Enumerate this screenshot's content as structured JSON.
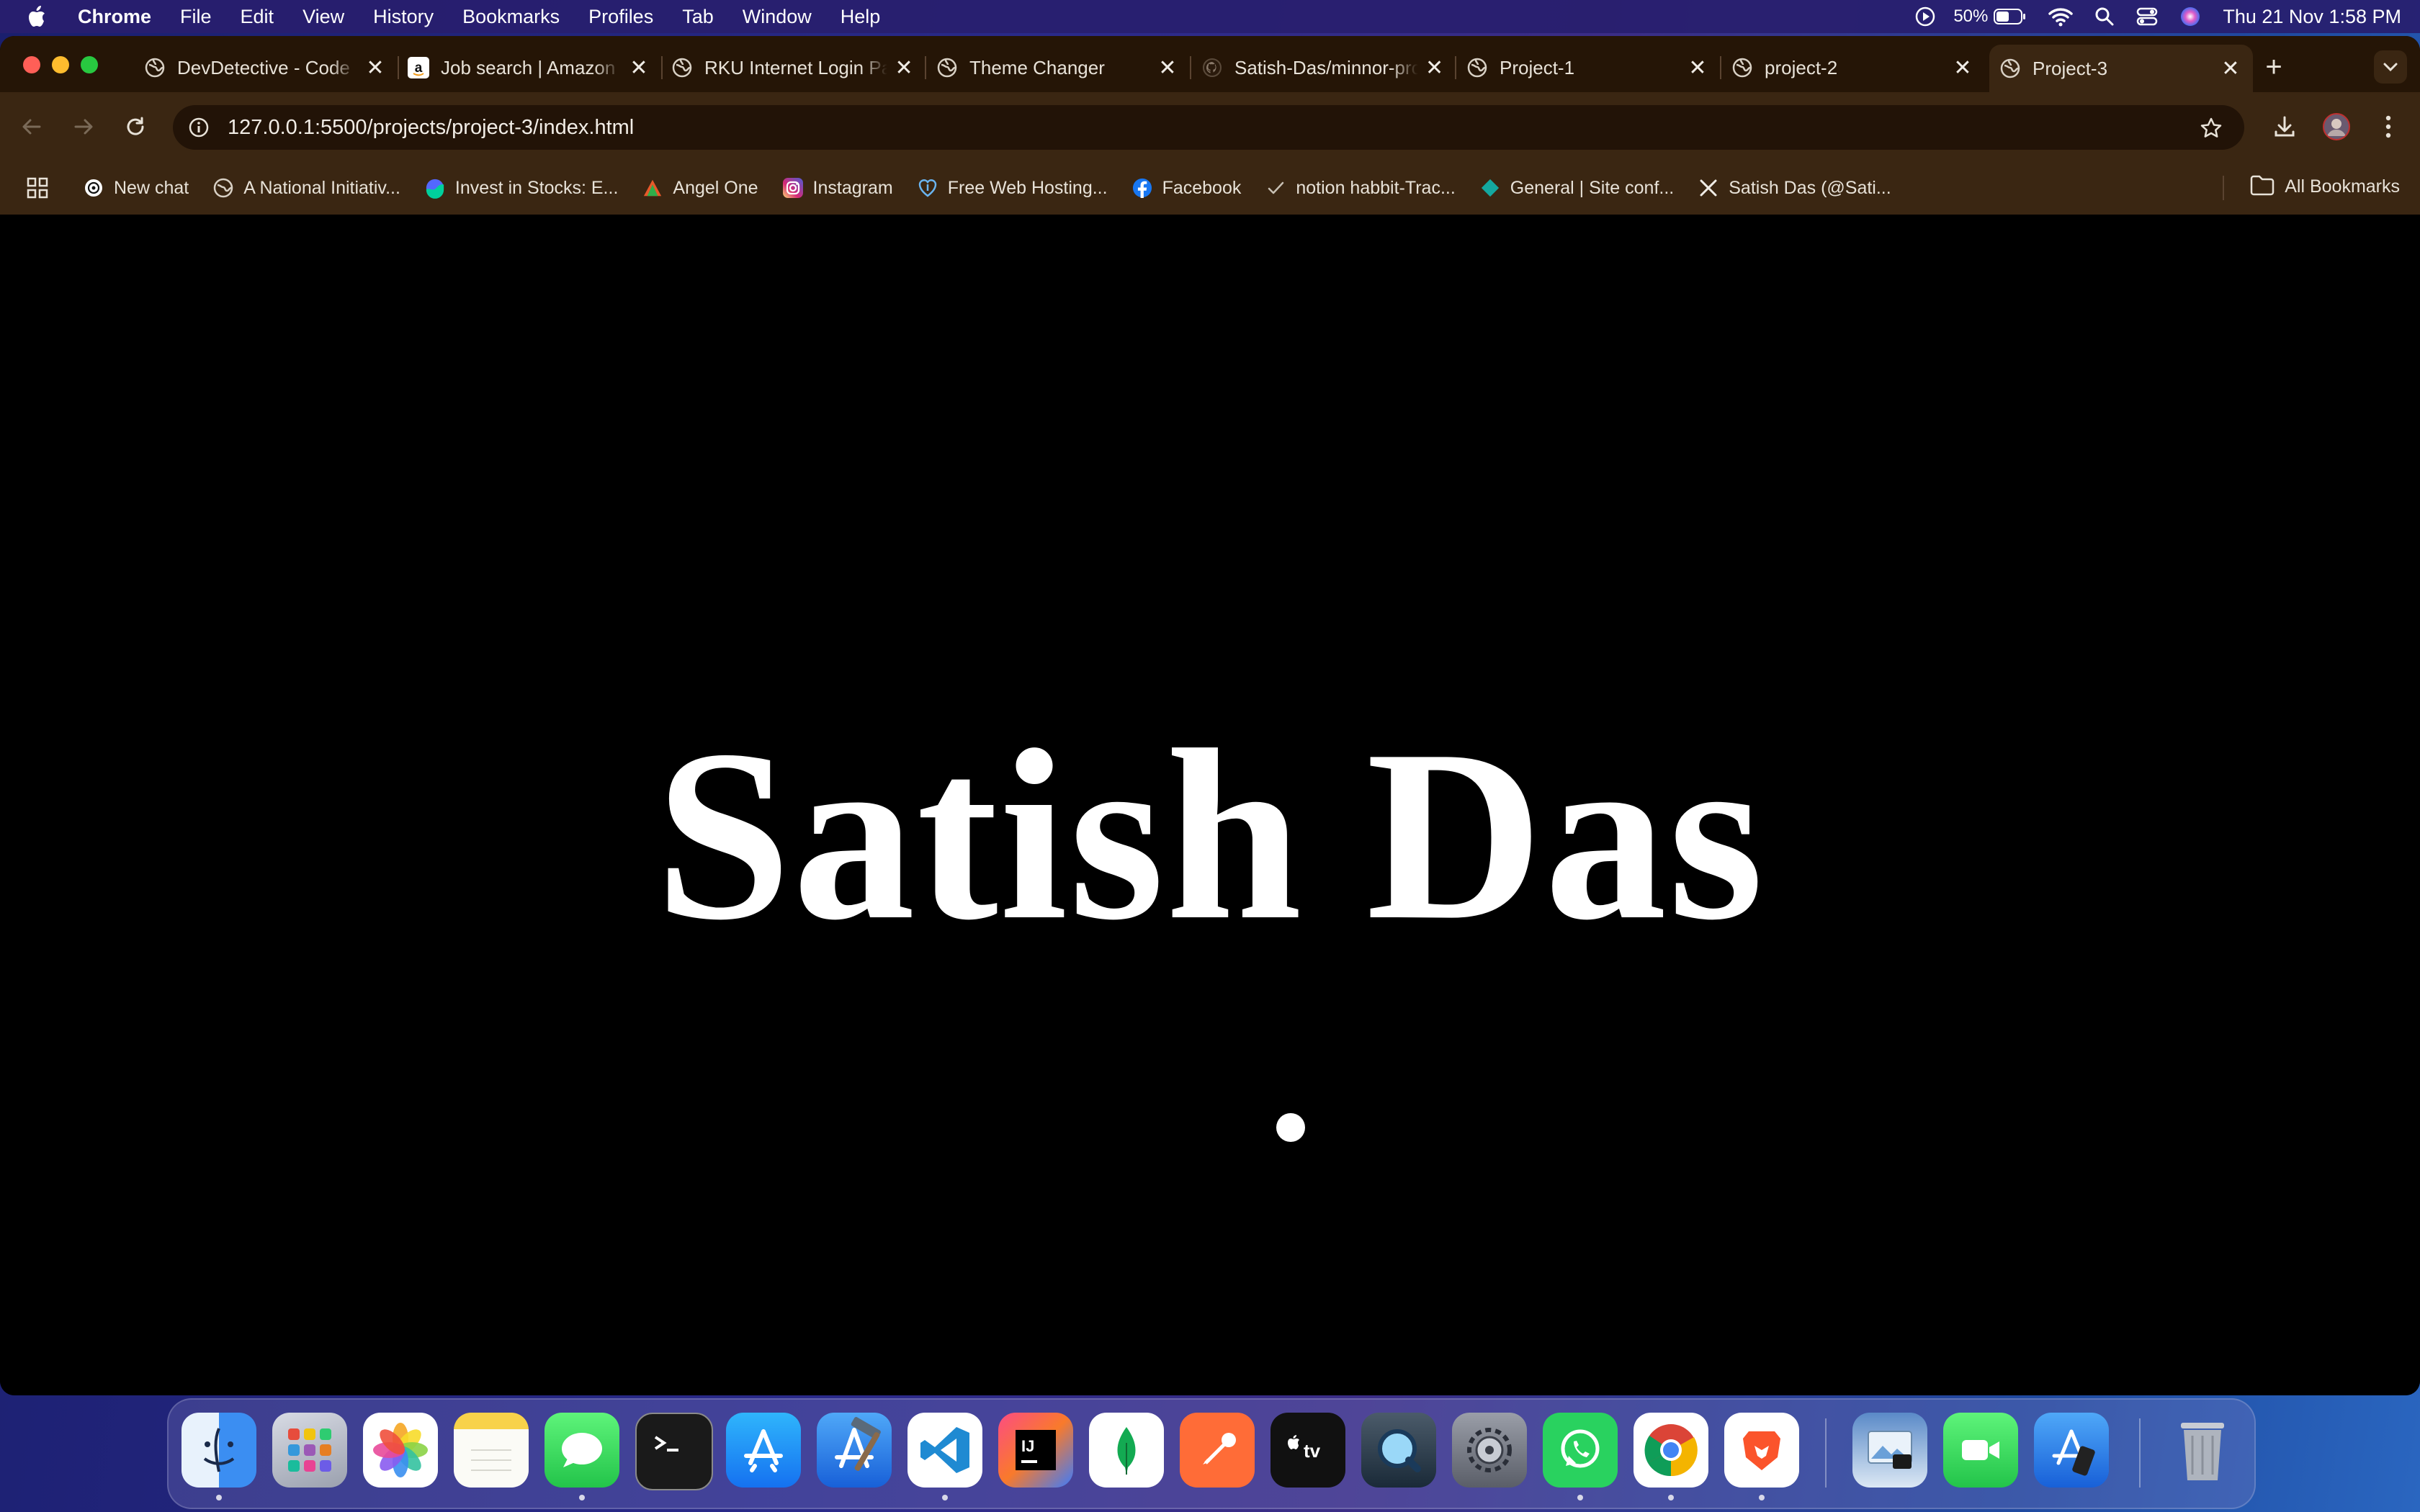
{
  "menubar": {
    "app_name": "Chrome",
    "menus": [
      "File",
      "Edit",
      "View",
      "History",
      "Bookmarks",
      "Profiles",
      "Tab",
      "Window",
      "Help"
    ],
    "battery_percent": "50%",
    "clock": "Thu 21 Nov  1:58 PM"
  },
  "tabs": [
    {
      "title": "DevDetective - Code",
      "icon": "globe-icon",
      "active": false
    },
    {
      "title": "Job search | Amazon",
      "icon": "amazon-icon",
      "active": false
    },
    {
      "title": "RKU Internet Login Page",
      "icon": "globe-icon",
      "active": false
    },
    {
      "title": "Theme Changer",
      "icon": "globe-icon",
      "active": false
    },
    {
      "title": "Satish-Das/minnor-project",
      "icon": "github-icon",
      "active": false
    },
    {
      "title": "Project-1",
      "icon": "globe-icon",
      "active": false
    },
    {
      "title": "project-2",
      "icon": "globe-icon",
      "active": false
    },
    {
      "title": "Project-3",
      "icon": "globe-icon",
      "active": true
    }
  ],
  "address_bar": {
    "url": "127.0.0.1:5500/projects/project-3/index.html"
  },
  "bookmarks": [
    {
      "label": "New chat",
      "icon": "openai-icon"
    },
    {
      "label": "A National Initiativ...",
      "icon": "globe-icon"
    },
    {
      "label": "Invest in Stocks: E...",
      "icon": "groww-icon"
    },
    {
      "label": "Angel One",
      "icon": "angelone-icon"
    },
    {
      "label": "Instagram",
      "icon": "instagram-icon"
    },
    {
      "label": "Free Web Hosting...",
      "icon": "hosting-icon"
    },
    {
      "label": "Facebook",
      "icon": "facebook-icon"
    },
    {
      "label": "notion habbit-Trac...",
      "icon": "check-icon"
    },
    {
      "label": "General | Site conf...",
      "icon": "netlify-icon"
    },
    {
      "label": "Satish Das (@Sati...",
      "icon": "x-icon"
    }
  ],
  "all_bookmarks_label": "All Bookmarks",
  "page": {
    "heading": "Satish Das"
  },
  "dock": [
    "finder-icon",
    "launchpad-icon",
    "photos-icon",
    "notes-icon",
    "messages-icon",
    "terminal-icon",
    "app-store-icon",
    "xcode-icon",
    "vscode-icon",
    "intellij-icon",
    "mongodb-compass-icon",
    "postman-icon",
    "apple-tv-icon",
    "quicktime-icon",
    "system-settings-icon",
    "whatsapp-icon",
    "chrome-icon",
    "brave-icon",
    "preview-icon",
    "facetime-icon",
    "simulator-icon",
    "trash-icon"
  ],
  "colors": {
    "tab_strip": "#251506",
    "toolbar": "#3a2612",
    "page_background": "#000000",
    "heading": "#ffffff"
  }
}
